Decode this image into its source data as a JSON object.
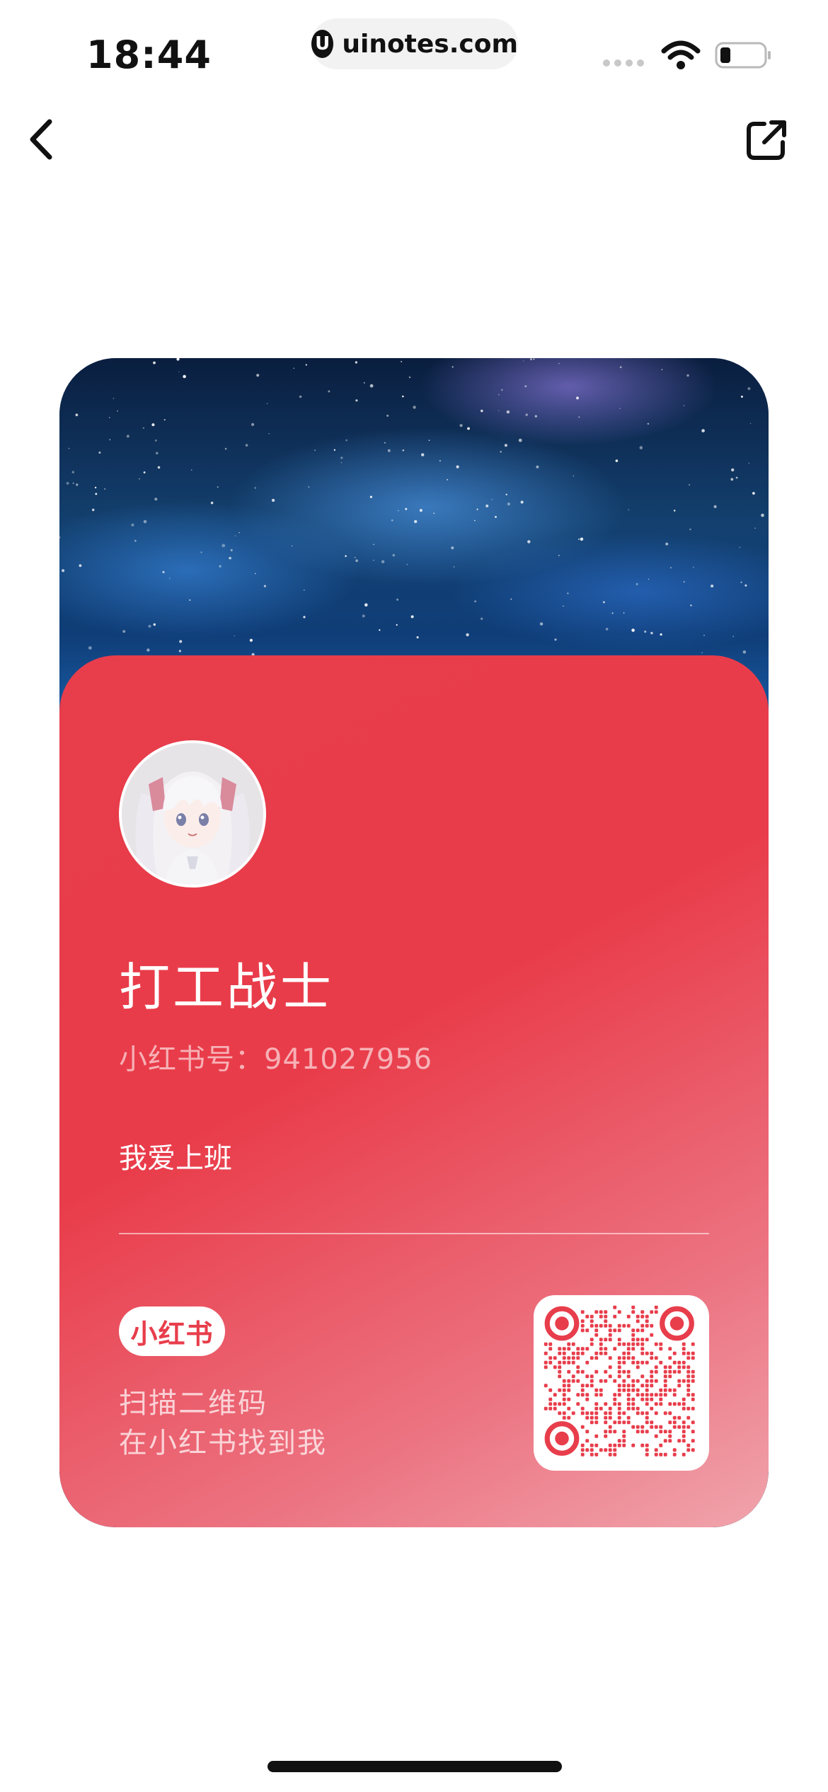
{
  "status_bar": {
    "time": "18:44",
    "url": "uinotes.com",
    "url_logo": "U"
  },
  "nav": {
    "back_icon": "chevron-left-icon",
    "share_icon": "share-external-icon"
  },
  "card": {
    "nickname": "打工战士",
    "red_id": "小红书号：941027956",
    "bio": "我爱上班",
    "brand": "小红书",
    "scan_line1": "扫描二维码",
    "scan_line2": "在小红书找到我",
    "colors": {
      "panel": "#e83d4b",
      "panel_fade": "#f0a4ac",
      "qr_accent": "#e83d4b"
    }
  }
}
